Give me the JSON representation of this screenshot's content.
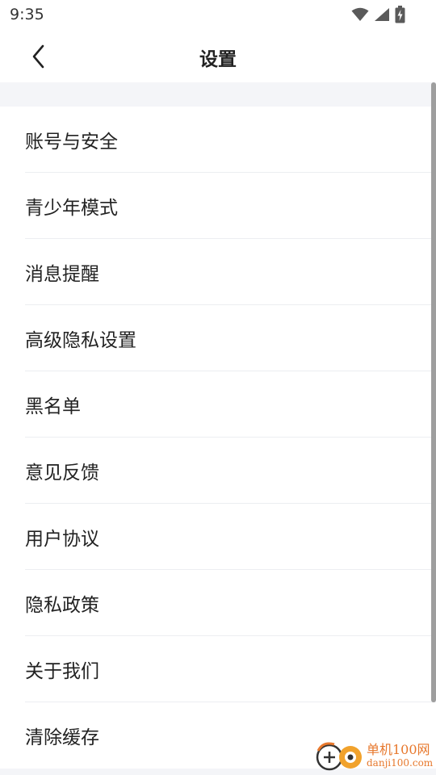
{
  "status_bar": {
    "time": "9:35"
  },
  "header": {
    "title": "设置"
  },
  "settings_items": [
    {
      "label": "账号与安全"
    },
    {
      "label": "青少年模式"
    },
    {
      "label": "消息提醒"
    },
    {
      "label": "高级隐私设置"
    },
    {
      "label": "黑名单"
    },
    {
      "label": "意见反馈"
    },
    {
      "label": "用户协议"
    },
    {
      "label": "隐私政策"
    },
    {
      "label": "关于我们"
    },
    {
      "label": "清除缓存"
    }
  ],
  "watermark": {
    "title": "单机100网",
    "subtitle": "danji100.com"
  },
  "colors": {
    "background": "#ffffff",
    "band": "#f4f5f8",
    "text": "#222222",
    "watermark": "#e7782d"
  }
}
